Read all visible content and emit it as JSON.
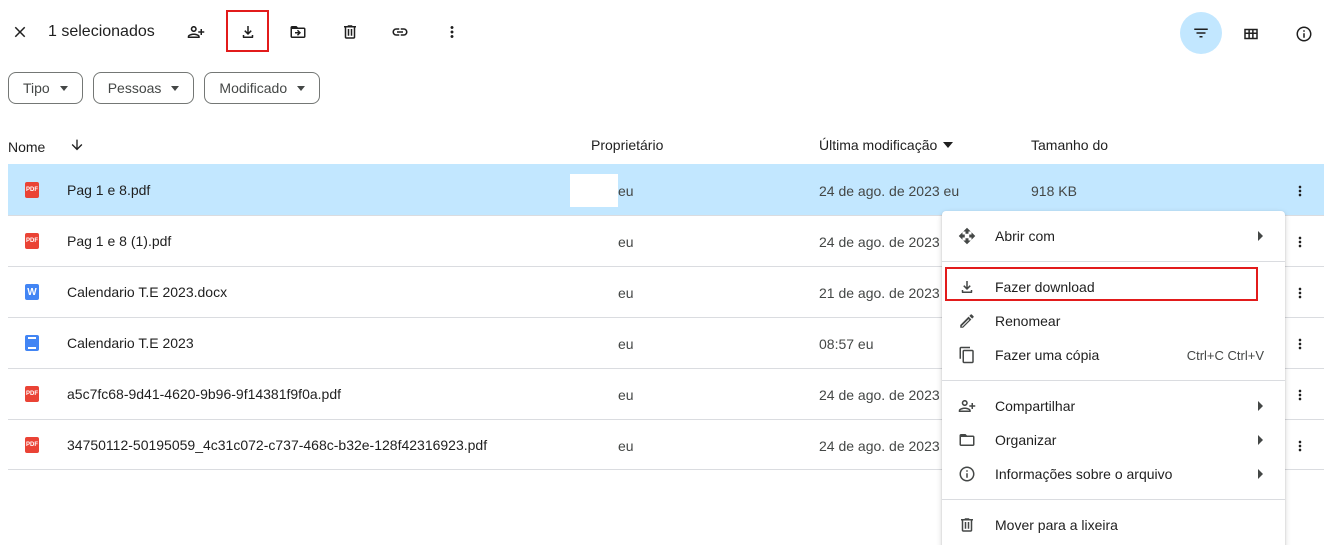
{
  "toolbar": {
    "selected_count": "1 selecionados",
    "actions": [
      "close-icon",
      "share-icon",
      "download-icon",
      "move-icon",
      "trash-icon",
      "link-icon",
      "more-vert-icon"
    ],
    "highlight_color": "#e21b1b"
  },
  "right_tools": [
    "filter-icon",
    "grid-view-icon",
    "info-icon"
  ],
  "filters": {
    "tipo": "Tipo",
    "pessoas": "Pessoas",
    "modificado": "Modificado"
  },
  "columns": {
    "name": "Nome",
    "owner": "Proprietário",
    "modified": "Última modificação",
    "size": "Tamanho do"
  },
  "files": [
    {
      "icon": "pdf-icon",
      "name": "Pag 1 e 8.pdf",
      "owner": "eu",
      "modified": "24 de ago. de 2023 eu",
      "size": "918 KB"
    },
    {
      "icon": "pdf-icon",
      "name": "Pag 1 e 8 (1).pdf",
      "owner": "eu",
      "modified": "24 de ago. de 2023",
      "size": ""
    },
    {
      "icon": "word-icon",
      "name": "Calendario T.E 2023.docx",
      "owner": "eu",
      "modified": "21 de ago. de 2023",
      "size": ""
    },
    {
      "icon": "google-doc-icon",
      "name": "Calendario T.E 2023",
      "owner": "eu",
      "modified": "08:57 eu",
      "size": ""
    },
    {
      "icon": "pdf-icon",
      "name": "a5c7fc68-9d41-4620-9b96-9f14381f9f0a.pdf",
      "owner": "eu",
      "modified": "24 de ago. de 2023",
      "size": ""
    },
    {
      "icon": "pdf-icon",
      "name": "34750112-50195059_4c31c072-c737-468c-b32e-128f42316923.pdf",
      "owner": "eu",
      "modified": "24 de ago. de 2023",
      "size": ""
    }
  ],
  "file_icon_text": {
    "pdf": "PDF",
    "word": "W"
  },
  "context_menu": {
    "open_with": "Abrir com",
    "download": "Fazer download",
    "rename": "Renomear",
    "copy": "Fazer uma cópia",
    "copy_shortcut": "Ctrl+C Ctrl+V",
    "share": "Compartilhar",
    "organize": "Organizar",
    "file_info": "Informações sobre o arquivo",
    "trash": "Mover para a lixeira"
  },
  "colors": {
    "selected_row": "#c2e7ff",
    "filter_active": "#c2e7ff",
    "pdf": "#ea4335",
    "doc": "#4285f4"
  }
}
